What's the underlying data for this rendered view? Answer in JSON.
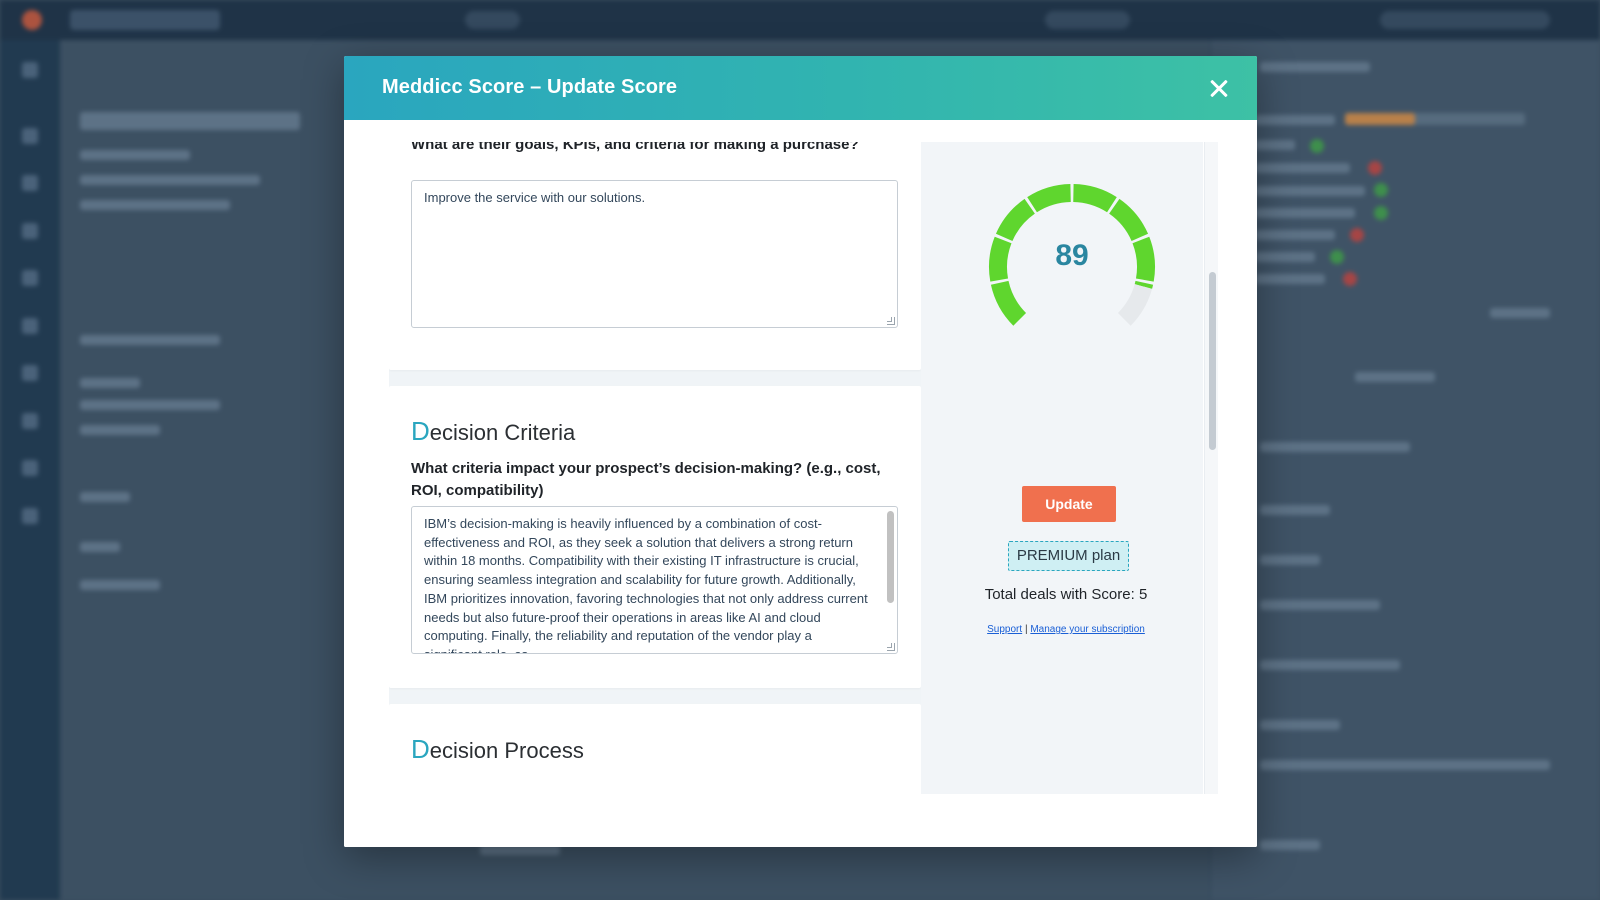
{
  "modal": {
    "title": "Meddicc Score – Update Score"
  },
  "goals_card": {
    "question": "What are their goals, KPIs, and criteria for making a purchase?",
    "answer": "Improve the service with our solutions."
  },
  "decision_criteria": {
    "heading_first": "D",
    "heading_rest": "ecision Criteria",
    "question": "What criteria impact your prospect’s decision-making? (e.g., cost, ROI, compatibility)",
    "answer": "IBM’s decision-making is heavily influenced by a combination of cost-effectiveness and ROI, as they seek a solution that delivers a strong return within 18 months. Compatibility with their existing IT infrastructure is crucial, ensuring seamless integration and scalability for future growth. Additionally, IBM prioritizes innovation, favoring technologies that not only address current needs but also future-proof their operations in areas like AI and cloud computing. Finally, the reliability and reputation of the vendor play a significant role, as"
  },
  "decision_process": {
    "heading_first": "D",
    "heading_rest": "ecision Process"
  },
  "score_panel": {
    "score_value": "89",
    "score_fraction": 0.89,
    "update_label": "Update",
    "plan_label": "PREMIUM plan",
    "deals_text": "Total deals with Score: 5",
    "support_link": "Support",
    "separator": "|",
    "manage_link": "Manage your subscription"
  },
  "colors": {
    "header_gradient_start": "#2aa6bf",
    "header_gradient_end": "#3dc1a5",
    "gauge_filled": "#5fd62e",
    "gauge_empty": "#e6e9ec",
    "score_text": "#2a86a0",
    "update_button": "#f0704e",
    "accent_letter": "#2aa6bf"
  }
}
